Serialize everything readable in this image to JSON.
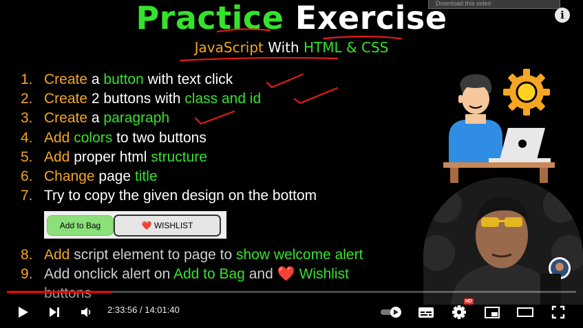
{
  "video": {
    "title": {
      "word1": "Practice",
      "word2": "Exercise"
    },
    "subtitle": {
      "part1": "JavaScript",
      "part2": "With",
      "part3": "HTML & CSS"
    },
    "tasks": [
      {
        "num": "1.",
        "a": "Create",
        "b": " a ",
        "c": "button",
        "d": " with text click",
        "e": ""
      },
      {
        "num": "2.",
        "a": "Create",
        "b": " 2 buttons with ",
        "c": "class and id",
        "d": "",
        "e": ""
      },
      {
        "num": "3.",
        "a": "Create",
        "b": " a ",
        "c": "paragraph",
        "d": "",
        "e": ""
      },
      {
        "num": "4.",
        "a": "Add",
        "b": " ",
        "c": "colors",
        "d": " to two buttons",
        "e": ""
      },
      {
        "num": "5.",
        "a": "Add",
        "b": " proper html ",
        "c": "structure",
        "d": "",
        "e": ""
      },
      {
        "num": "6.",
        "a": "Change",
        "b": " page ",
        "c": "title",
        "d": "",
        "e": ""
      },
      {
        "num": "7.",
        "a": "",
        "b": "Try to copy the given design on the bottom",
        "c": "",
        "d": "",
        "e": ""
      }
    ],
    "demo": {
      "add_to_bag": "Add to Bag",
      "wishlist": "WISHLIST",
      "heart": "❤️"
    },
    "tasks2": {
      "t8": {
        "num": "8.",
        "a": "Add",
        "b": " script element to page to ",
        "c": "show welcome alert"
      },
      "t9": {
        "num": "9.",
        "a": "Add onclick alert on ",
        "b": "Add to Bag",
        "c": " and ",
        "heart": "❤️",
        "d": " Wishlist"
      },
      "t9_cont": "buttons"
    },
    "top_button": "Download this video",
    "info_icon": "i"
  },
  "player": {
    "time_current": "2:33:56",
    "time_separator": " / ",
    "time_total": "14:01:40",
    "progress": 0.183,
    "hd_badge": "HD",
    "icons": [
      "play-icon",
      "next-icon",
      "volume-icon",
      "autoplay-toggle-icon",
      "subtitles-icon",
      "settings-icon",
      "miniplayer-icon",
      "theater-icon",
      "fullscreen-icon"
    ]
  },
  "colors": {
    "green": "#35e22c",
    "orange": "#f5a623",
    "red": "#ff0000"
  }
}
